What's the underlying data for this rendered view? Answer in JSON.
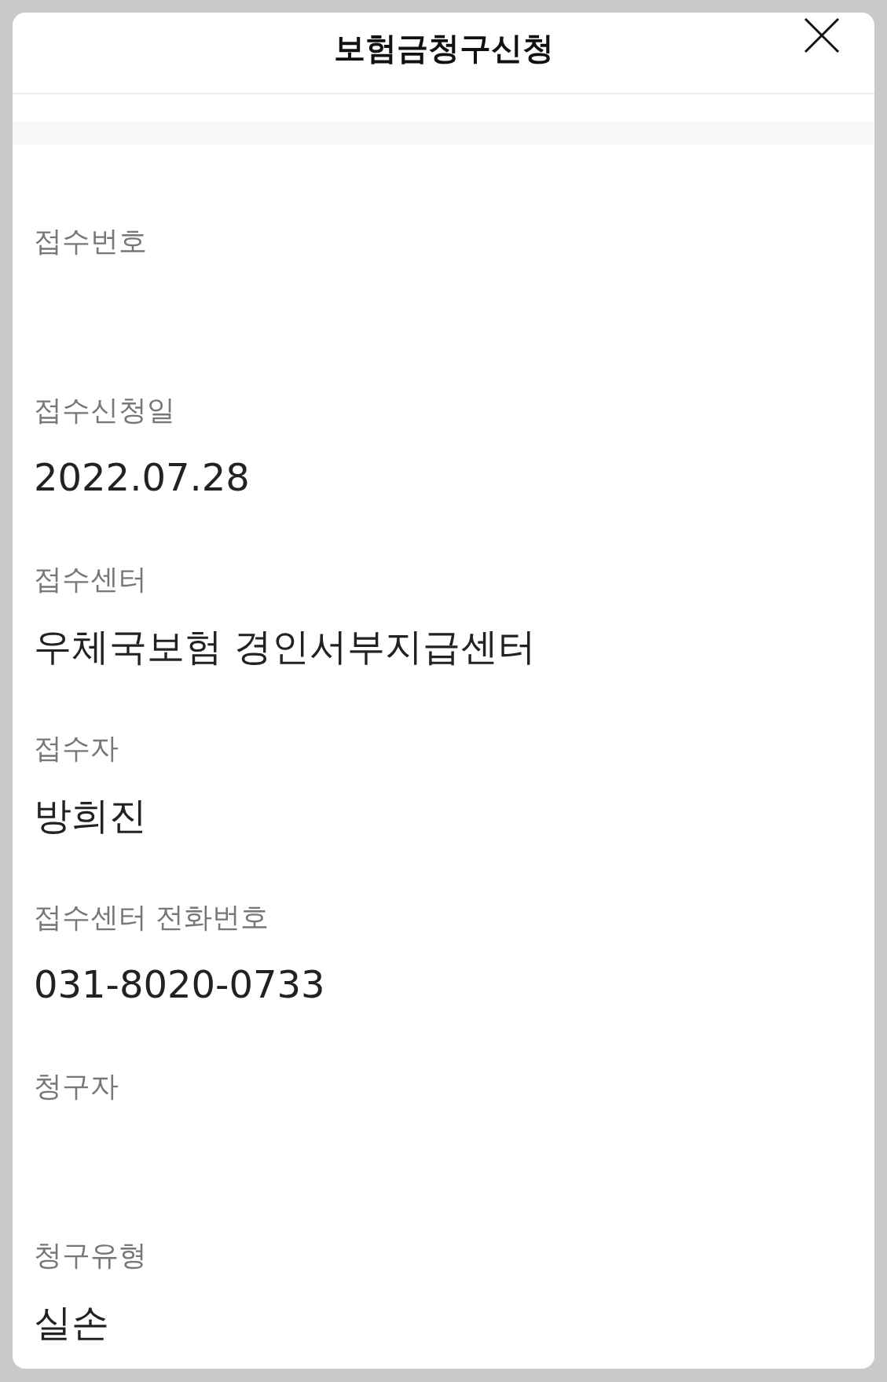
{
  "dialog": {
    "title": "보험금청구신청",
    "fields": [
      {
        "label": "접수번호"
      },
      {
        "label": "접수신청일",
        "value": "2022.07.28"
      },
      {
        "label": "접수센터",
        "value": "우체국보험 경인서부지급센터"
      },
      {
        "label": "접수자",
        "value": "방희진"
      },
      {
        "label": "접수센터 전화번호",
        "value": "031-8020-0733"
      },
      {
        "label": "청구자"
      },
      {
        "label": "청구유형",
        "value": "실손"
      }
    ]
  }
}
